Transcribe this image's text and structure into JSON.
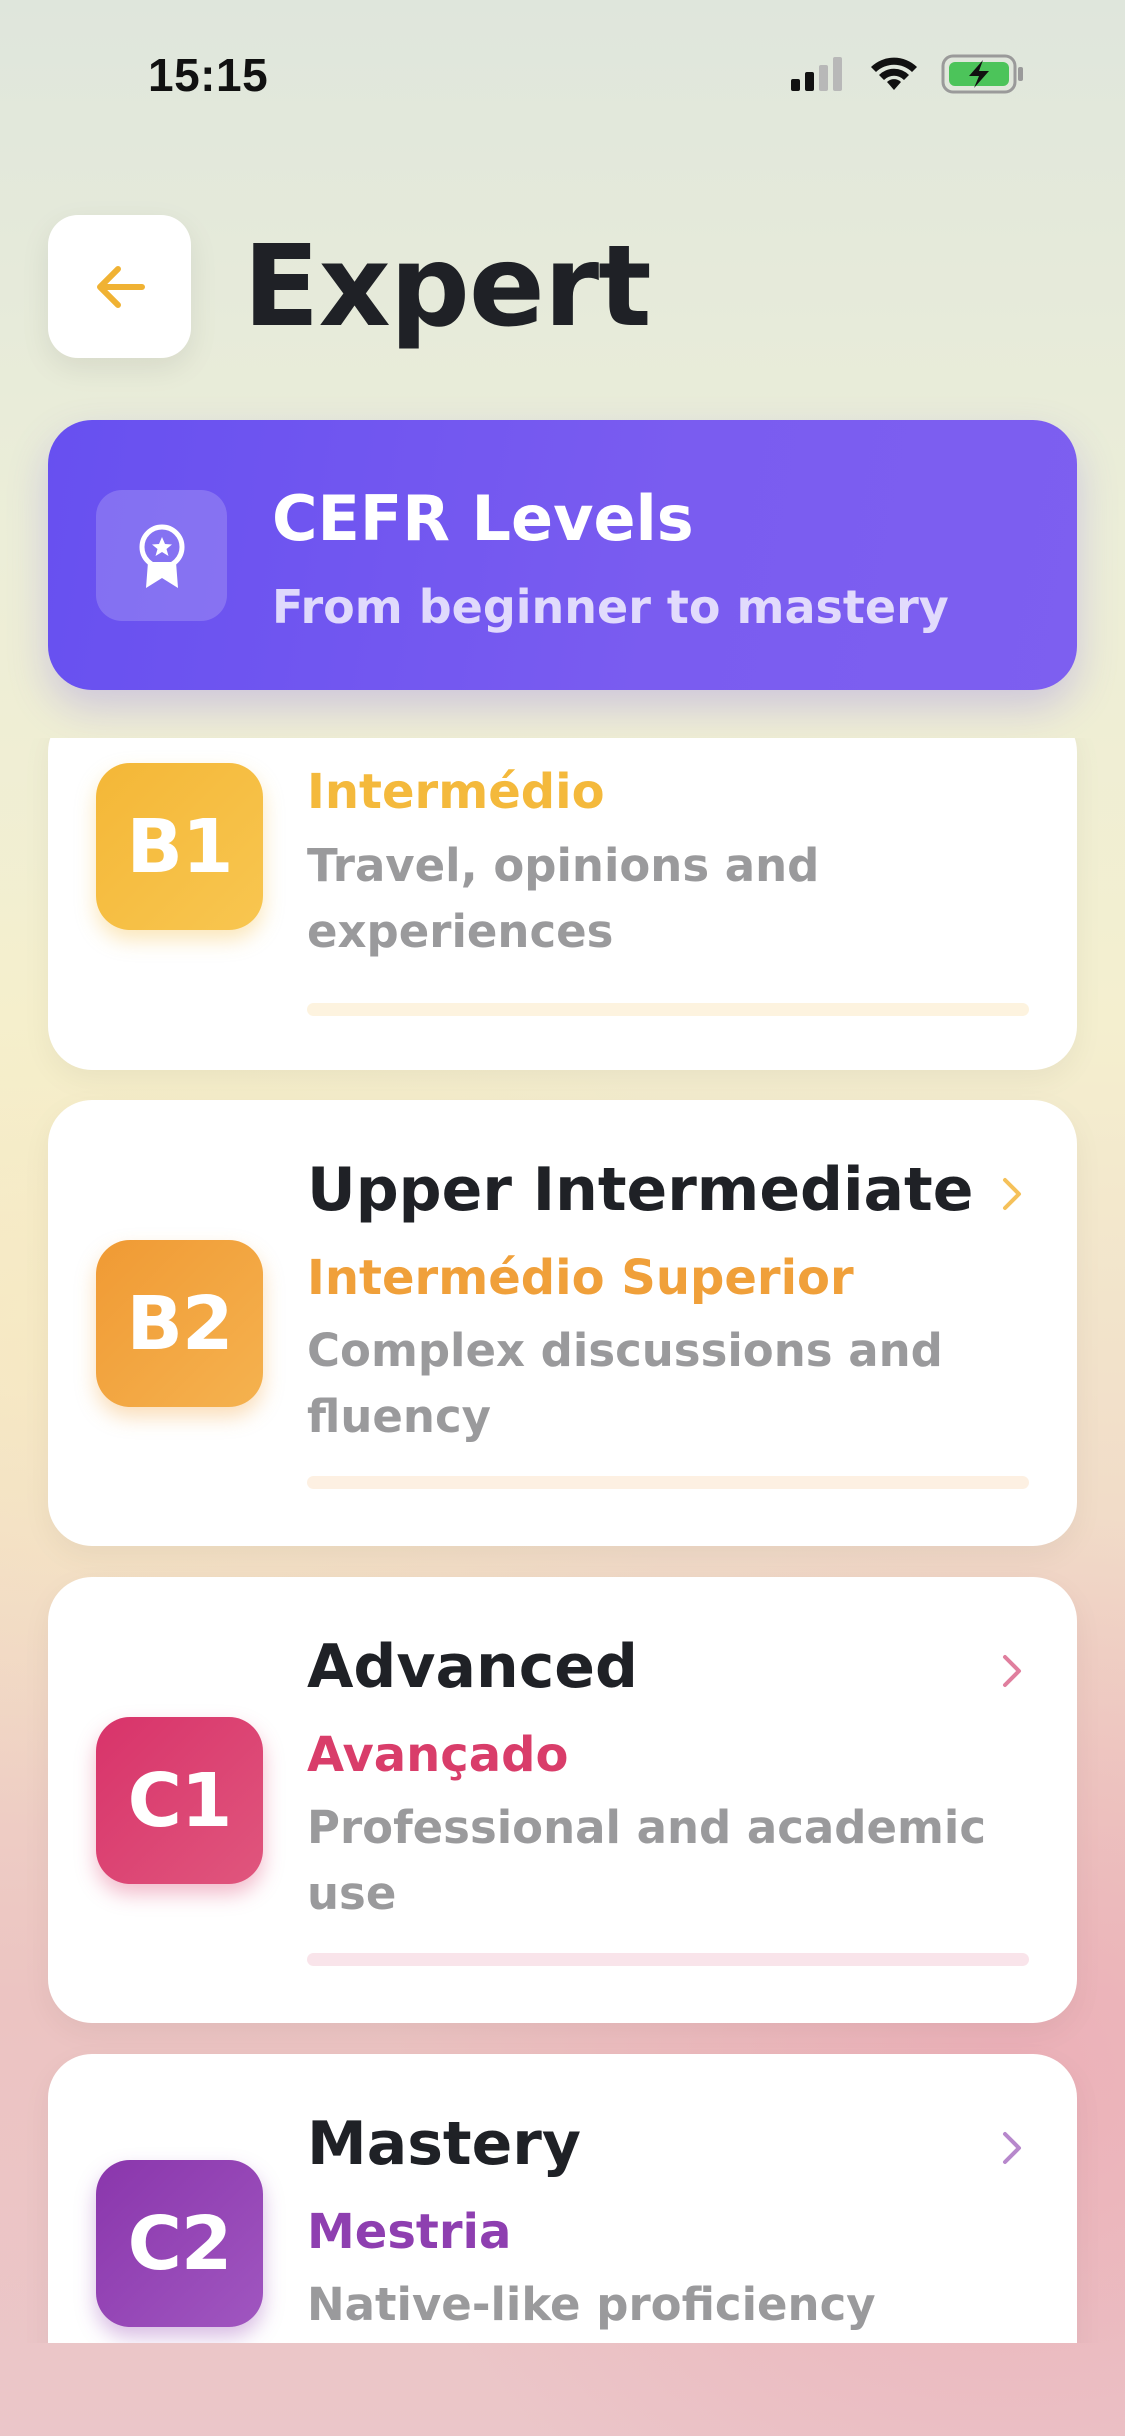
{
  "status_bar": {
    "time": "15:15"
  },
  "header": {
    "title": "Expert",
    "back_icon": "arrow-left-icon"
  },
  "banner": {
    "title": "CEFR Levels",
    "subtitle": "From beginner to mastery",
    "icon": "award-badge-icon"
  },
  "colors": {
    "banner_start": "#6750f0",
    "banner_end": "#7d5ff0",
    "b1": "#f4b93c",
    "b2": "#f0a03a",
    "c1": "#d93d6a",
    "c2": "#8e3fb0",
    "title_text": "#1f2126",
    "desc_text": "#9a9a9c"
  },
  "levels": [
    {
      "code": "B1",
      "title": "",
      "native": "Intermédio",
      "description": "Travel, opinions and experiences",
      "progress": 0
    },
    {
      "code": "B2",
      "title": "Upper Intermediate",
      "native": "Intermédio Superior",
      "description": "Complex discussions and fluency",
      "progress": 0
    },
    {
      "code": "C1",
      "title": "Advanced",
      "native": "Avançado",
      "description": "Professional and academic use",
      "progress": 0
    },
    {
      "code": "C2",
      "title": "Mastery",
      "native": "Mestria",
      "description": "Native-like proficiency",
      "progress": 0
    }
  ]
}
